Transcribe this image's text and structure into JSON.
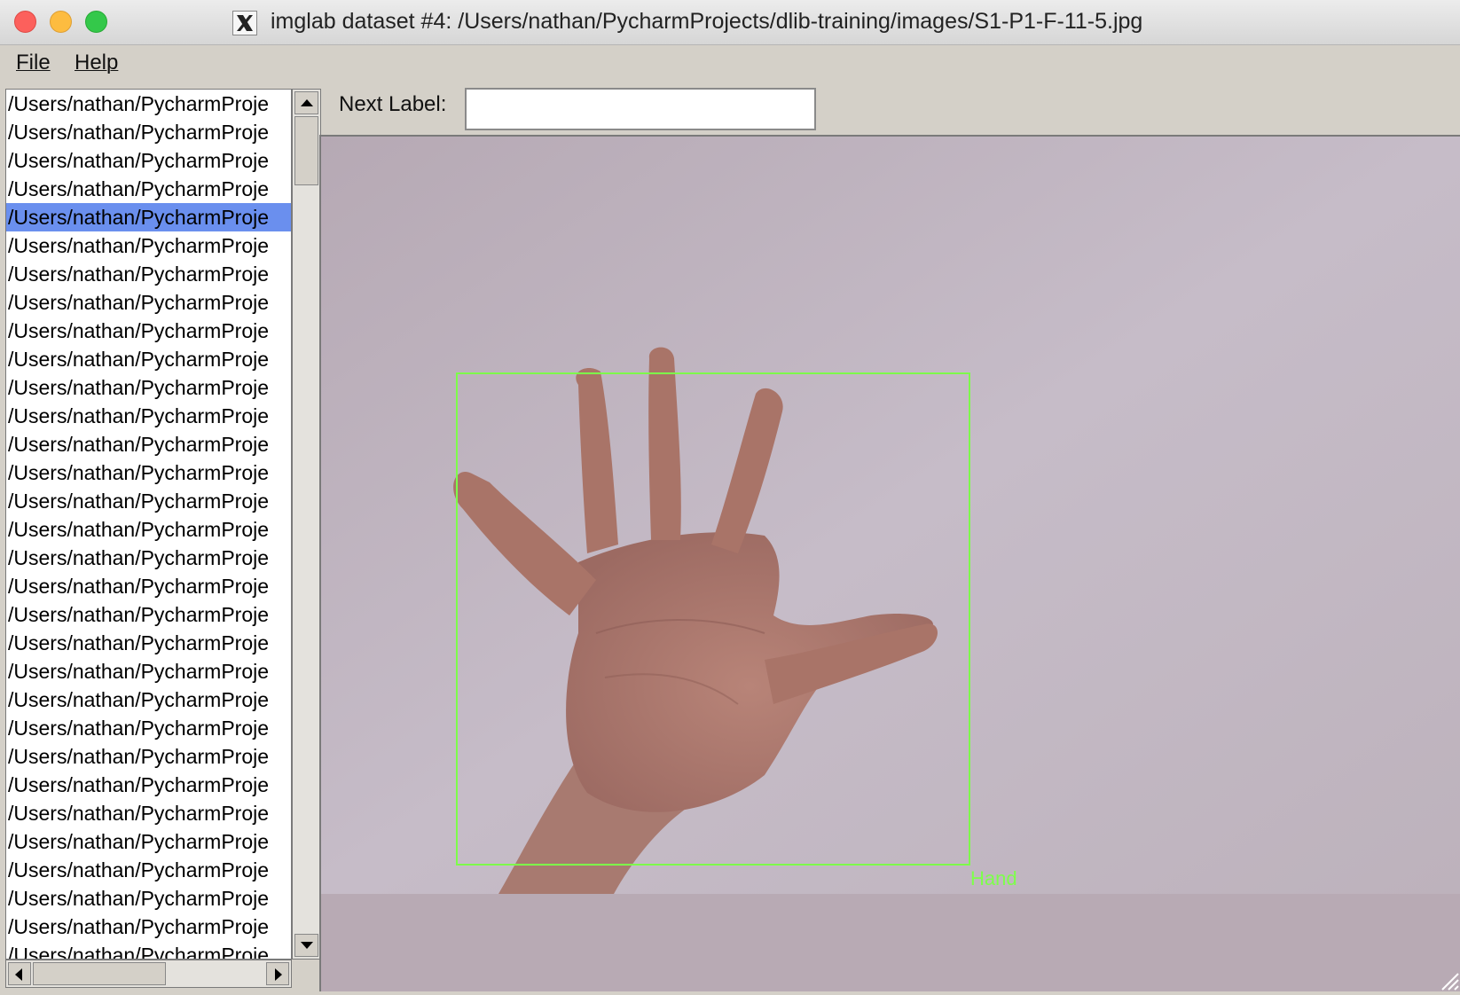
{
  "window": {
    "title": "imglab dataset #4: /Users/nathan/PycharmProjects/dlib-training/images/S1-P1-F-11-5.jpg"
  },
  "menu": {
    "file_label": "File",
    "help_label": "Help"
  },
  "file_list": {
    "items": [
      "/Users/nathan/PycharmProje",
      "/Users/nathan/PycharmProje",
      "/Users/nathan/PycharmProje",
      "/Users/nathan/PycharmProje",
      "/Users/nathan/PycharmProje",
      "/Users/nathan/PycharmProje",
      "/Users/nathan/PycharmProje",
      "/Users/nathan/PycharmProje",
      "/Users/nathan/PycharmProje",
      "/Users/nathan/PycharmProje",
      "/Users/nathan/PycharmProje",
      "/Users/nathan/PycharmProje",
      "/Users/nathan/PycharmProje",
      "/Users/nathan/PycharmProje",
      "/Users/nathan/PycharmProje",
      "/Users/nathan/PycharmProje",
      "/Users/nathan/PycharmProje",
      "/Users/nathan/PycharmProje",
      "/Users/nathan/PycharmProje",
      "/Users/nathan/PycharmProje",
      "/Users/nathan/PycharmProje",
      "/Users/nathan/PycharmProje",
      "/Users/nathan/PycharmProje",
      "/Users/nathan/PycharmProje",
      "/Users/nathan/PycharmProje",
      "/Users/nathan/PycharmProje",
      "/Users/nathan/PycharmProje",
      "/Users/nathan/PycharmProje",
      "/Users/nathan/PycharmProje",
      "/Users/nathan/PycharmProje",
      "/Users/nathan/PycharmProje"
    ],
    "selected_index": 4
  },
  "toolbar": {
    "next_label_text": "Next Label:",
    "next_label_value": ""
  },
  "annotation": {
    "label": "Hand"
  },
  "colors": {
    "selection": "#6a8fee",
    "bbox": "#7dff4a",
    "canvas_bg": "#b8aab4"
  }
}
